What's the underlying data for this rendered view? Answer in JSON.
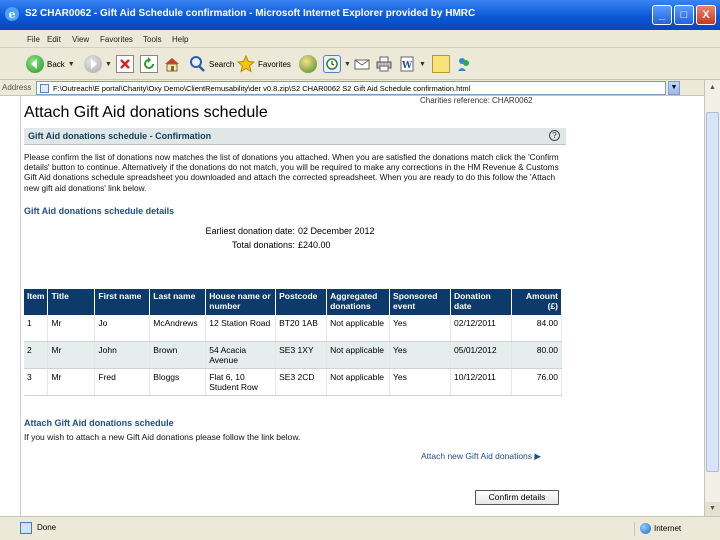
{
  "window": {
    "title": "S2 CHAR0062 - Gift Aid Schedule confirmation - Microsoft Internet Explorer provided by HMRC",
    "min": "_",
    "max": "□",
    "close": "X"
  },
  "menu": [
    "File",
    "Edit",
    "View",
    "Favorites",
    "Tools",
    "Help"
  ],
  "toolbar": {
    "back": "Back",
    "search": "Search",
    "favorites": "Favorites"
  },
  "address": {
    "label": "Address",
    "value": "F:\\Outreach\\E portal\\Charity\\Oxy Demo\\ClientRemusability\\der v0.8.zip\\S2 CHAR0062     S2 Gift Aid Schedule confirmation.html"
  },
  "page": {
    "customer_ref": "Charities reference: CHAR0062",
    "title": "Attach Gift Aid donations schedule",
    "panel_title": "Gift Aid donations schedule - Confirmation",
    "help_icon": "?",
    "paragraph": "Please confirm the list of donations now matches the list of donations you attached. When you are satisfied the donations match click the 'Confirm details' button to continue. Alternatively if the donations do not match, you will be required to make any corrections in the HM Revenue & Customs Gift Aid donations schedule spreadsheet you downloaded and attach the corrected spreadsheet. When you are ready to do this follow the 'Attach new gift aid donations' link below.",
    "details_heading": "Gift Aid donations schedule details",
    "summary": {
      "earliest_label": "Earliest donation date:",
      "earliest_value": "02 December 2012",
      "total_label": "Total donations:",
      "total_value": "£240.00"
    },
    "table": {
      "headers": [
        "Item",
        "Title",
        "First name",
        "Last name",
        "House name or number",
        "Postcode",
        "Aggregated donations",
        "Sponsored event",
        "Donation date",
        "Amount (£)"
      ],
      "rows": [
        [
          "1",
          "Mr",
          "Jo",
          "McAndrews",
          "12 Station Road",
          "BT20 1AB",
          "Not applicable",
          "Yes",
          "02/12/2011",
          "84.00"
        ],
        [
          "2",
          "Mr",
          "John",
          "Brown",
          "54 Acacia Avenue",
          "SE3 1XY",
          "Not applicable",
          "Yes",
          "05/01/2012",
          "80.00"
        ],
        [
          "3",
          "Mr",
          "Fred",
          "Bloggs",
          "Flat 6, 10 Student Row",
          "SE3 2CD",
          "Not applicable",
          "Yes",
          "10/12/2011",
          "76.00"
        ]
      ]
    },
    "attach_title": "Attach Gift Aid donations schedule",
    "attach_desc": "If you wish to attach a new Gift Aid donations please follow the link below.",
    "attach_link": "Attach new Gift Aid donations ▶",
    "confirm_button": "Confirm details"
  },
  "status": {
    "text": "Done",
    "zone": "Internet"
  },
  "colors": {
    "titlebar": "#0a58d8",
    "table_header": "#0b3a6b",
    "link": "#1f4f8a",
    "panel_header": "#dfe7e7"
  }
}
